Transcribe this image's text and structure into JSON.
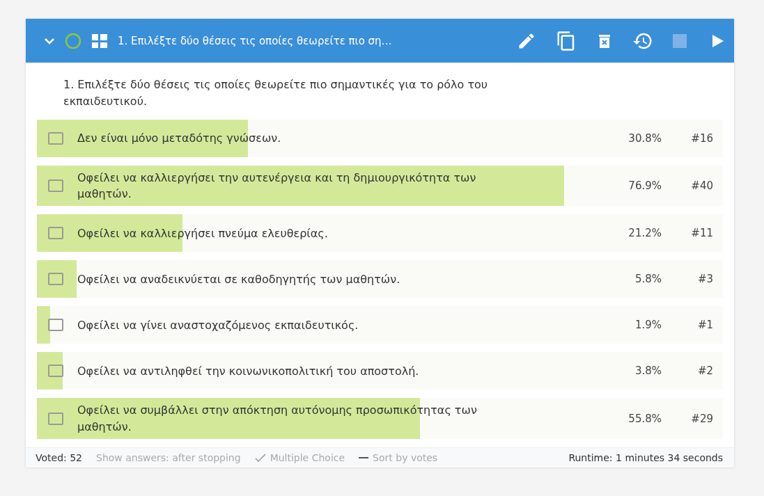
{
  "header": {
    "title": "1. Επιλέξτε δύο θέσεις τις οποίες θεωρείτε πιο ση…",
    "expanded": true
  },
  "question": "1. Επιλέξτε δύο θέσεις τις οποίες θεωρείτε πιο σημαντικές για το ρόλο του εκπαιδευτικού.",
  "options": [
    {
      "text": "Δεν είναι μόνο μεταδότης γνώσεων.",
      "percent": "30.8%",
      "votes": "#16",
      "level": 0.308,
      "checked": false
    },
    {
      "text": "Οφείλει να καλλιεργήσει την αυτενέργεια και τη δημιουργικότητα των μαθητών.",
      "percent": "76.9%",
      "votes": "#40",
      "level": 0.769,
      "checked": false
    },
    {
      "text": "Οφείλει να καλλιεργήσει πνεύμα ελευθερίας.",
      "percent": "21.2%",
      "votes": "#11",
      "level": 0.212,
      "checked": false
    },
    {
      "text": "Οφείλει να αναδεικνύεται σε καθοδηγητής των μαθητών.",
      "percent": "5.8%",
      "votes": "#3",
      "level": 0.058,
      "checked": false
    },
    {
      "text": "Οφείλει να γίνει αναστοχαζόμενος εκπαιδευτικός.",
      "percent": "1.9%",
      "votes": "#1",
      "level": 0.019,
      "checked": false
    },
    {
      "text": "Οφείλει να αντιληφθεί την κοινωνικοπολιτική του αποστολή.",
      "percent": "3.8%",
      "votes": "#2",
      "level": 0.038,
      "checked": false
    },
    {
      "text": "Οφείλει να συμβάλλει στην απόκτηση αυτόνομης προσωπικότητας των μαθητών.",
      "percent": "55.8%",
      "votes": "#29",
      "level": 0.558,
      "checked": false
    }
  ],
  "footer": {
    "voted": "Voted: 52",
    "show_answers": "Show answers: after stopping",
    "type": "Multiple Choice",
    "sort": "Sort by votes",
    "runtime": "Runtime: 1 minutes 34 seconds"
  }
}
